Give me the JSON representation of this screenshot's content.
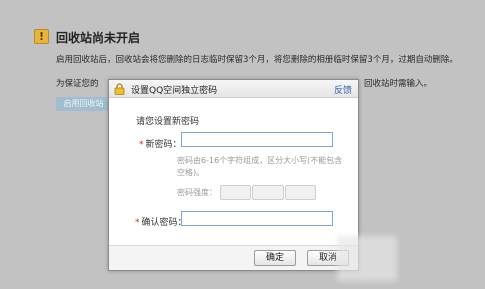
{
  "page": {
    "title": "回收站尚未开启",
    "notice_icon": "!",
    "line1": "启用回收站后，回收站会将您删除的日志临时保留3个月，将您删除的相册临时保留3个月，过期自动删除。",
    "line2_left": "为保证您的",
    "line2_right": "回收站时需输入。",
    "enable_button": "启用回收站"
  },
  "dialog": {
    "title": "设置QQ空间独立密码",
    "feedback": "反馈",
    "section_title": "请您设置新密码",
    "new_password_label": "新密码：",
    "hint": "密码由6-16个字符组成，区分大小写(不能包含空格)。",
    "strength_label": "密码强度：",
    "confirm_label": "确认密码：",
    "ok_button": "确定",
    "cancel_button": "取消"
  },
  "colors": {
    "accent": "#2d64b3",
    "input_border": "#7aa7d6",
    "required": "#dd2222",
    "notice": "#e9b43c"
  },
  "icons": {
    "notice": "exclamation-icon",
    "dialog": "lock-icon"
  }
}
